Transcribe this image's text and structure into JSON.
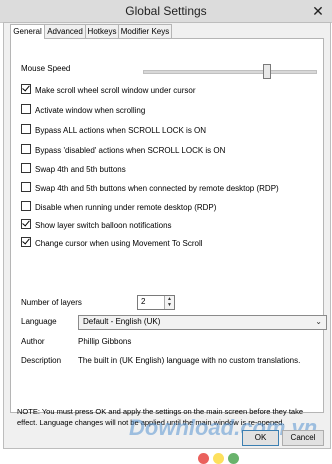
{
  "window": {
    "title": "Global Settings",
    "close_glyph": "✕"
  },
  "tabs": [
    {
      "label": "General",
      "active": true
    },
    {
      "label": "Advanced",
      "active": false
    },
    {
      "label": "Hotkeys",
      "active": false
    },
    {
      "label": "Modifier Keys",
      "active": false
    }
  ],
  "mouse_speed": {
    "label": "Mouse Speed",
    "value_fraction": 0.72
  },
  "checkboxes": [
    {
      "label": "Make scroll wheel scroll window under cursor",
      "checked": true
    },
    {
      "label": "Activate window when scrolling",
      "checked": false
    },
    {
      "label": "Bypass ALL actions when SCROLL LOCK is ON",
      "checked": false
    },
    {
      "label": "Bypass 'disabled' actions when SCROLL LOCK is ON",
      "checked": false
    },
    {
      "label": "Swap 4th and 5th buttons",
      "checked": false
    },
    {
      "label": "Swap 4th and 5th buttons when connected by remote desktop (RDP)",
      "checked": false
    },
    {
      "label": "Disable when running under remote desktop (RDP)",
      "checked": false
    },
    {
      "label": "Show layer switch balloon notifications",
      "checked": true
    },
    {
      "label": "Change cursor when using Movement To Scroll",
      "checked": true
    }
  ],
  "layers": {
    "label": "Number of layers",
    "value": "2"
  },
  "language": {
    "label": "Language",
    "selected": "Default - English (UK)"
  },
  "author": {
    "label": "Author",
    "value": "Phillip Gibbons"
  },
  "description": {
    "label": "Description",
    "value": "The built in (UK English) language with no custom translations."
  },
  "note": "NOTE: You must press OK and apply the settings on the main screen before they take effect. Language changes will not be applied until the main window is re-opened.",
  "buttons": {
    "ok": "OK",
    "cancel": "Cancel"
  },
  "watermark": {
    "text": "Download.com.vn"
  }
}
